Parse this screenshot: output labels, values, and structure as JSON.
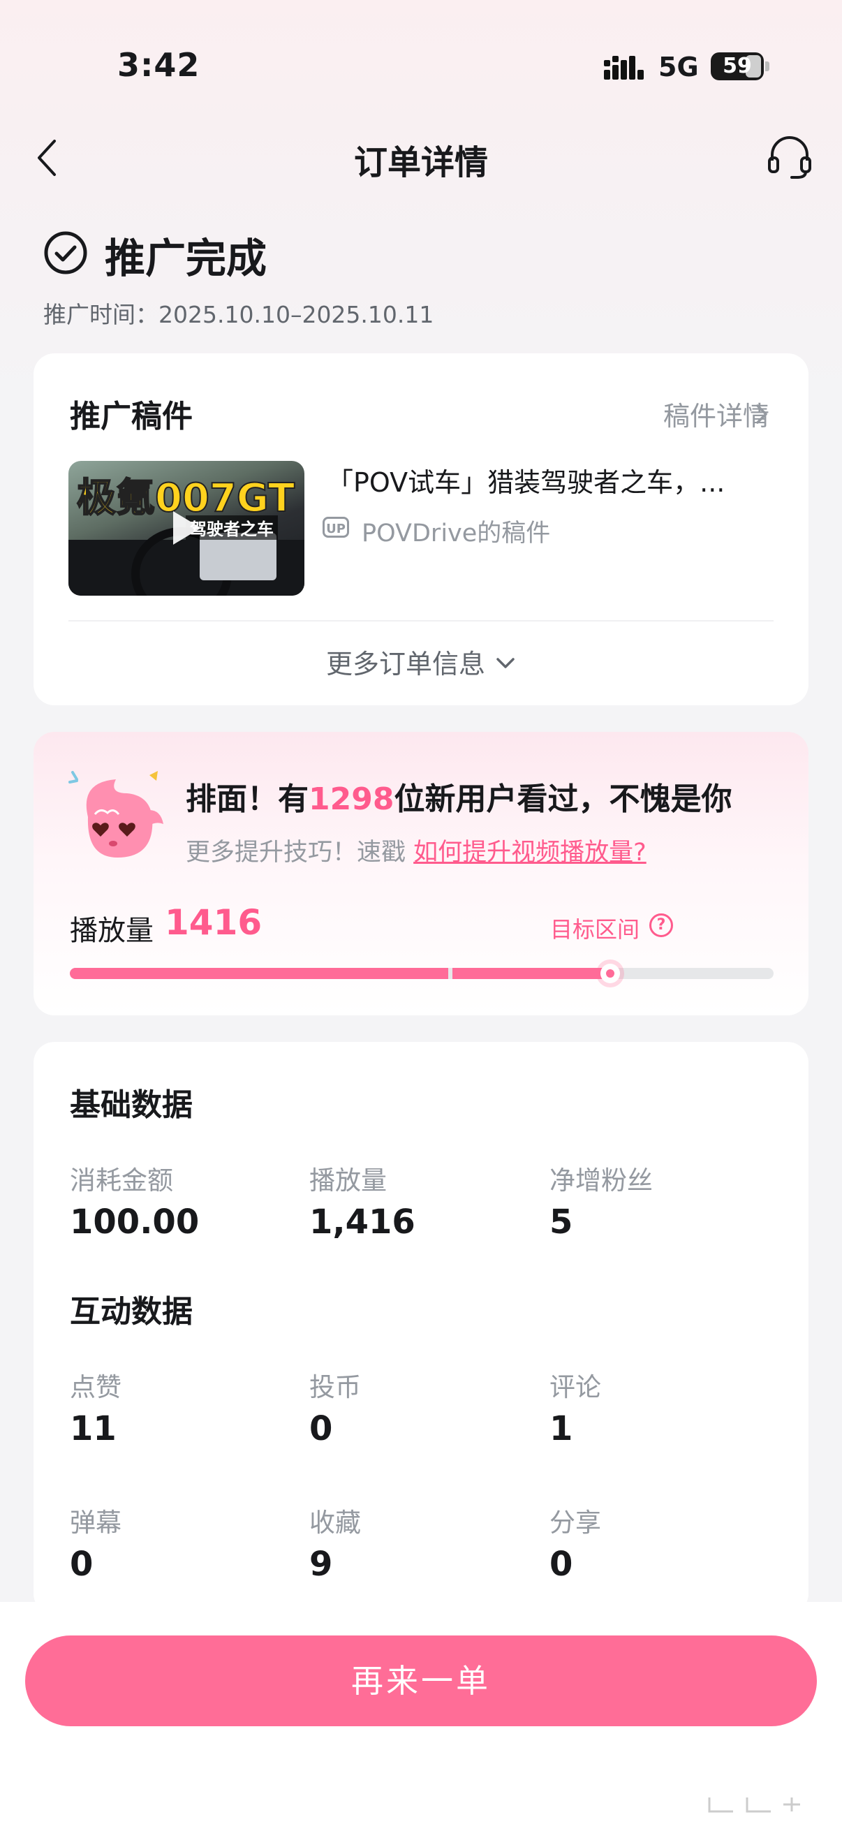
{
  "status_bar": {
    "time": "3:42",
    "network": "5G",
    "battery": "59"
  },
  "nav": {
    "title": "订单详情",
    "back_icon": "chevron-left-icon",
    "support_icon": "headset-icon"
  },
  "order_status": {
    "title": "推广完成",
    "period": "推广时间：2025.10.10–2025.10.11"
  },
  "draft": {
    "section_title": "推广稿件",
    "details_link": "稿件详情",
    "thumbnail_text_main": "极氪007GT",
    "thumbnail_text_sub": "驾驶者之车",
    "video_title": "「POV试车」猎装驾驶者之车，...",
    "up_badge": "UP",
    "uploader": "POVDrive的稿件",
    "more_info": "更多订单信息"
  },
  "performance": {
    "headline_prefix": "排面！有",
    "headline_number": "1298",
    "headline_suffix": "位新用户看过，不愧是你",
    "tip_prefix": "更多提升技巧！速戳 ",
    "tip_link": "如何提升视频播放量?",
    "views_label": "播放量",
    "views_value": "1416",
    "target_label": "目标区间",
    "help_icon": "?",
    "progress_fraction": 0.77,
    "accent_color": "#ff5b8d"
  },
  "basic_data": {
    "section_title": "基础数据",
    "items": [
      {
        "label": "消耗金额",
        "value": "100.00"
      },
      {
        "label": "播放量",
        "value": "1,416"
      },
      {
        "label": "净增粉丝",
        "value": "5"
      }
    ]
  },
  "interaction_data": {
    "section_title": "互动数据",
    "items": [
      {
        "label": "点赞",
        "value": "11"
      },
      {
        "label": "投币",
        "value": "0"
      },
      {
        "label": "评论",
        "value": "1"
      },
      {
        "label": "弹幕",
        "value": "0"
      },
      {
        "label": "收藏",
        "value": "9"
      },
      {
        "label": "分享",
        "value": "0"
      }
    ]
  },
  "action": {
    "reorder_label": "再来一单",
    "button_color": "#ff6d97"
  }
}
